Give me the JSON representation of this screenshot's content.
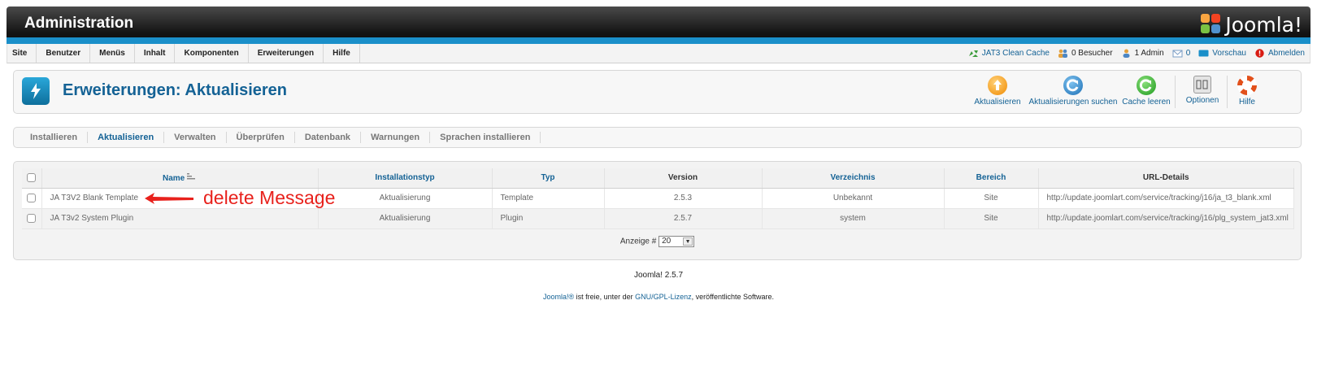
{
  "header": {
    "app_title": "Administration",
    "logo_text": "Joomla!"
  },
  "menubar": {
    "items": [
      "Site",
      "Benutzer",
      "Menüs",
      "Inhalt",
      "Komponenten",
      "Erweiterungen",
      "Hilfe"
    ],
    "status": {
      "clean_cache": "JAT3 Clean Cache",
      "visitors": "0 Besucher",
      "admins": "1 Admin",
      "messages": "0",
      "preview": "Vorschau",
      "logout": "Abmelden"
    }
  },
  "toolbar": {
    "page_title": "Erweiterungen: Aktualisieren",
    "buttons": {
      "update": "Aktualisieren",
      "find_updates": "Aktualisierungen suchen",
      "clear_cache": "Cache leeren",
      "options": "Optionen",
      "help": "Hilfe"
    }
  },
  "subtabs": [
    "Installieren",
    "Aktualisieren",
    "Verwalten",
    "Überprüfen",
    "Datenbank",
    "Warnungen",
    "Sprachen installieren"
  ],
  "table": {
    "headers": {
      "name": "Name",
      "install_type": "Installationstyp",
      "type": "Typ",
      "version": "Version",
      "folder": "Verzeichnis",
      "client": "Bereich",
      "url": "URL-Details"
    },
    "rows": [
      {
        "name": "JA T3V2 Blank Template",
        "install_type": "Aktualisierung",
        "type": "Template",
        "version": "2.5.3",
        "folder": "Unbekannt",
        "client": "Site",
        "url": "http://update.joomlart.com/service/tracking/j16/ja_t3_blank.xml"
      },
      {
        "name": "JA T3v2 System Plugin",
        "install_type": "Aktualisierung",
        "type": "Plugin",
        "version": "2.5.7",
        "folder": "system",
        "client": "Site",
        "url": "http://update.joomlart.com/service/tracking/j16/plg_system_jat3.xml"
      }
    ],
    "pager": {
      "label": "Anzeige #",
      "value": "20"
    }
  },
  "annotation": {
    "text": "delete Message"
  },
  "footer": {
    "version": "Joomla! 2.5.7",
    "license_link1": "Joomla!®",
    "license_text1": " ist freie, unter der ",
    "license_link2": "GNU/GPL-Lizenz",
    "license_text2": ", veröffentlichte Software."
  },
  "colors": {
    "accent_blue": "#146295",
    "header_strip": "#1a8fc9",
    "annotation_red": "#e8211c"
  }
}
